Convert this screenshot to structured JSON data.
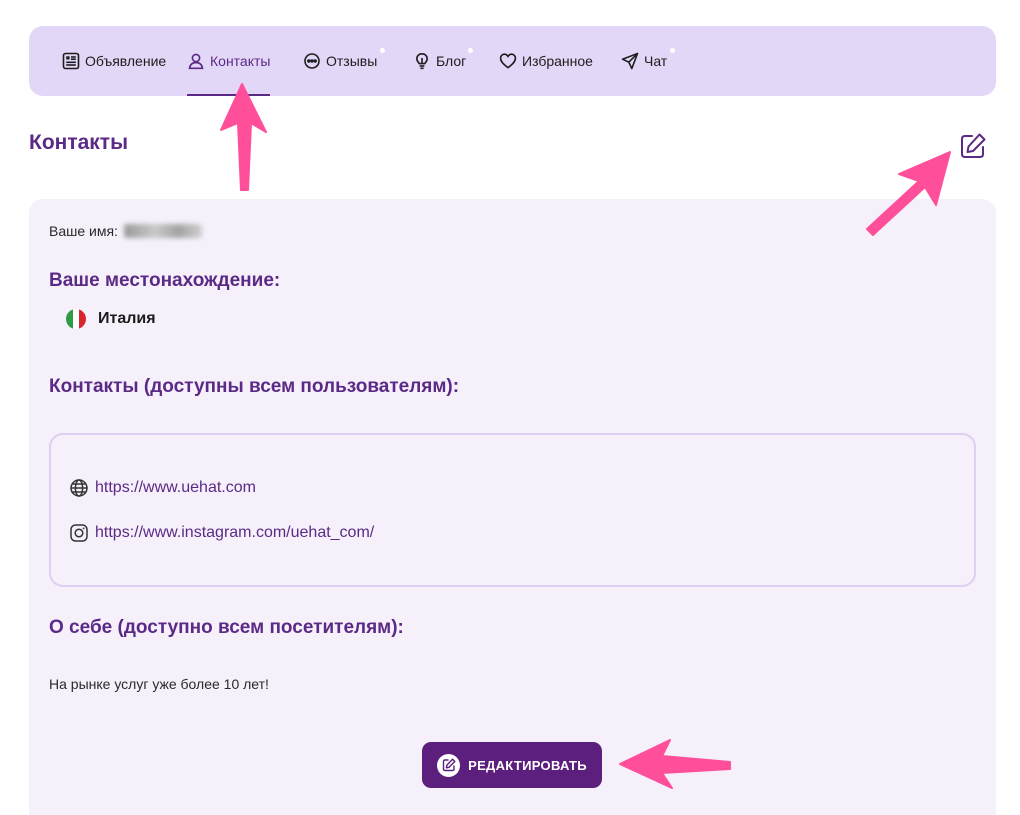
{
  "nav": {
    "tabs": [
      {
        "label": "Объявление",
        "icon": "listing-icon"
      },
      {
        "label": "Контакты",
        "icon": "user-icon",
        "active": true
      },
      {
        "label": "Отзывы",
        "icon": "chat-icon",
        "badge": true
      },
      {
        "label": "Блог",
        "icon": "lightbulb-icon",
        "badge": true
      },
      {
        "label": "Избранное",
        "icon": "heart-icon"
      },
      {
        "label": "Чат",
        "icon": "send-icon",
        "badge": true
      }
    ]
  },
  "page": {
    "title": "Контакты",
    "edit_icon": "edit-icon"
  },
  "profile": {
    "name_label": "Ваше имя:",
    "location_heading": "Ваше местонахождение:",
    "country": "Италия",
    "contacts_heading": "Контакты (доступны всем пользователям):",
    "contacts": [
      {
        "icon": "globe-icon",
        "url": "https://www.uehat.com"
      },
      {
        "icon": "instagram-icon",
        "url": "https://www.instagram.com/uehat_com/"
      }
    ],
    "about_heading": "О себе (доступно всем посетителям):",
    "about_text": "На рынке услуг уже более 10 лет!"
  },
  "actions": {
    "edit_label": "РЕДАКТИРОВАТЬ"
  },
  "colors": {
    "accent": "#5b2a86",
    "nav_bg": "#e3d7f7",
    "card_bg": "#f5f0fa",
    "button": "#5c1f7d",
    "arrow": "#ff4f9a"
  }
}
